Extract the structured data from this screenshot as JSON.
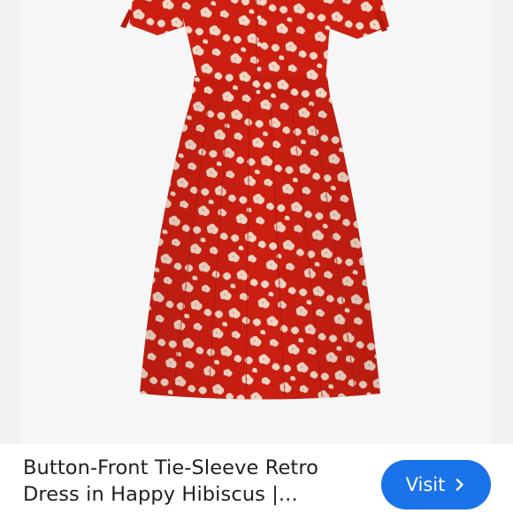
{
  "product_card": {
    "image": {
      "subject": "dress-photo",
      "colors": {
        "dress": "#cc1f12",
        "dress_shadow": "#a8150b",
        "print": "#f3d6c4",
        "background": "#f6f6f6"
      }
    },
    "title_line_1": "Button-Front Tie-Sleeve Retro",
    "title_line_2": "Dress in Happy Hibiscus |...",
    "visit_button": {
      "label": "Visit",
      "icon": "chevron-right-icon",
      "color": "#1a73e8"
    }
  }
}
